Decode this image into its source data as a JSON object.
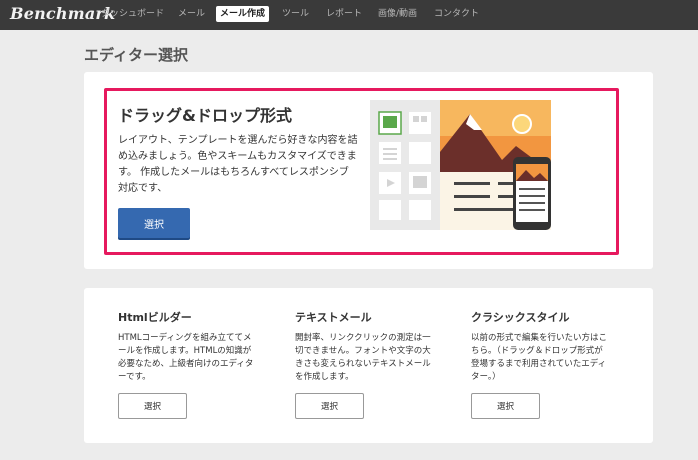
{
  "app": {
    "logo": "Benchmark"
  },
  "nav": {
    "items": [
      {
        "label": "ダッシュボード"
      },
      {
        "label": "メール"
      },
      {
        "label": "メール作成",
        "active": true
      },
      {
        "label": "ツール"
      },
      {
        "label": "レポート"
      },
      {
        "label": "画像/動画"
      },
      {
        "label": "コンタクト"
      }
    ]
  },
  "page": {
    "title": "エディター選択"
  },
  "dragdrop": {
    "title": "ドラッグ&ドロップ形式",
    "description": "レイアウト、テンプレートを選んだら好きな内容を詰め込みましょう。色やスキームもカスタマイズできます。 作成したメールはもちろんすべてレスポンシブ対応です、",
    "button_label": "選択"
  },
  "options": [
    {
      "title": "Htmlビルダー",
      "description": "HTMLコーディングを組み立ててメールを作成します。HTMLの知識が必要なため、上級者向けのエディターです。",
      "button_label": "選択"
    },
    {
      "title": "テキストメール",
      "description": "開封率、リンククリックの測定は一切できません。フォントや文字の大きさも変えられないテキストメールを作成します。",
      "button_label": "選択"
    },
    {
      "title": "クラシックスタイル",
      "description": "以前の形式で編集を行いたい方はこちら。（ドラッグ＆ドロップ形式が登場するまで利用されていたエディター。）",
      "button_label": "選択"
    }
  ],
  "colors": {
    "nav_bg": "#3a3a3a",
    "highlight_border": "#e6195e",
    "primary_button": "#3569b0"
  }
}
